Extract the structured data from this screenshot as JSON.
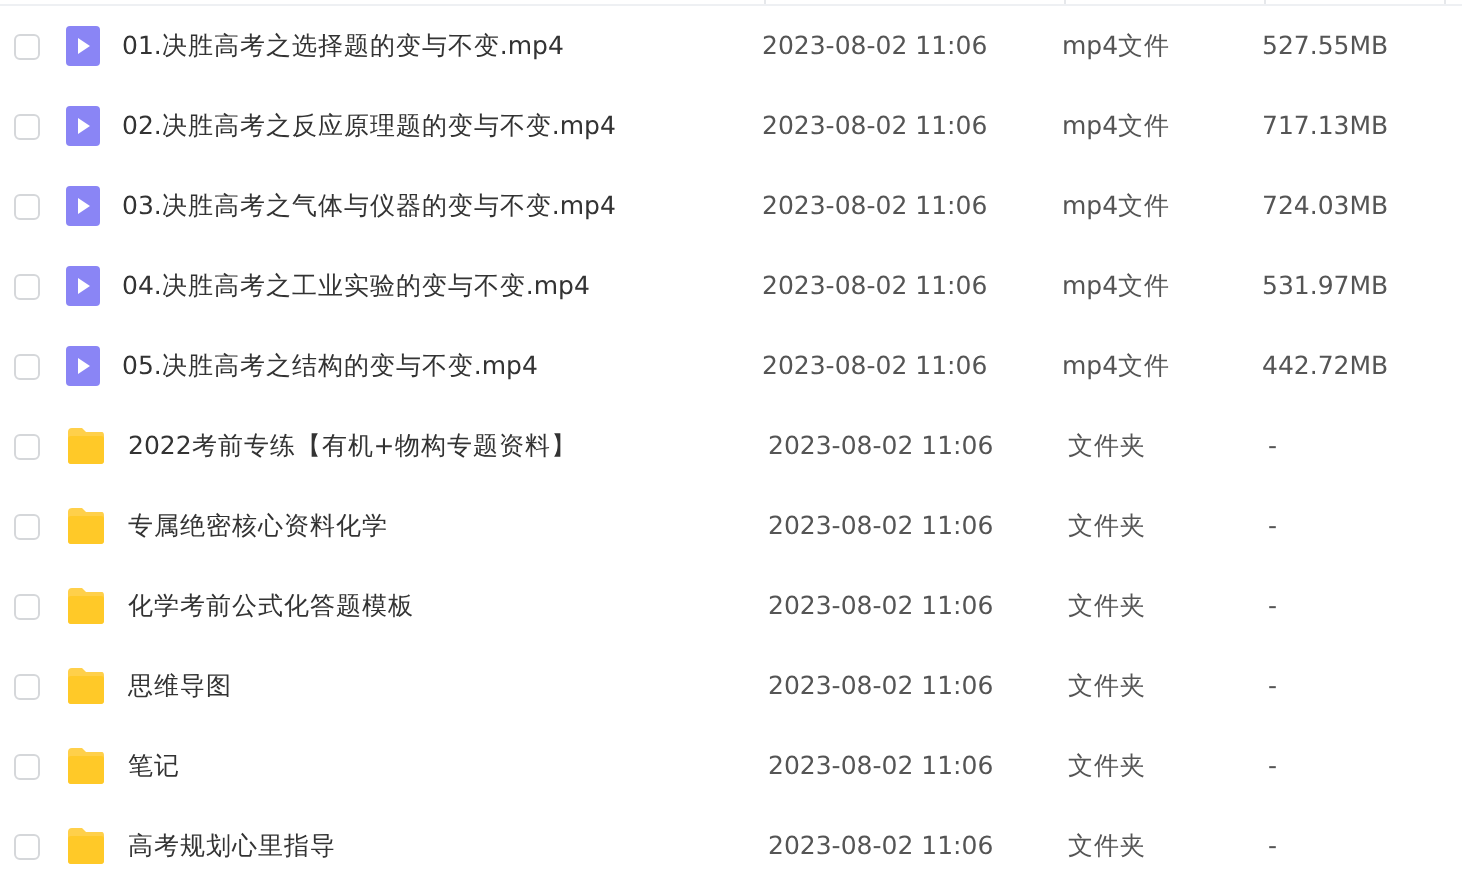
{
  "files": [
    {
      "kind": "video",
      "checked": false,
      "name": "01.决胜高考之选择题的变与不变.mp4",
      "modified": "2023-08-02 11:06",
      "type": "mp4文件",
      "size": "527.55MB"
    },
    {
      "kind": "video",
      "checked": false,
      "name": "02.决胜高考之反应原理题的变与不变.mp4",
      "modified": "2023-08-02 11:06",
      "type": "mp4文件",
      "size": "717.13MB"
    },
    {
      "kind": "video",
      "checked": false,
      "name": "03.决胜高考之气体与仪器的变与不变.mp4",
      "modified": "2023-08-02 11:06",
      "type": "mp4文件",
      "size": "724.03MB"
    },
    {
      "kind": "video",
      "checked": false,
      "name": "04.决胜高考之工业实验的变与不变.mp4",
      "modified": "2023-08-02 11:06",
      "type": "mp4文件",
      "size": "531.97MB"
    },
    {
      "kind": "video",
      "checked": false,
      "name": "05.决胜高考之结构的变与不变.mp4",
      "modified": "2023-08-02 11:06",
      "type": "mp4文件",
      "size": "442.72MB"
    },
    {
      "kind": "folder",
      "checked": false,
      "name": "2022考前专练【有机+物构专题资料】",
      "modified": "2023-08-02 11:06",
      "type": "文件夹",
      "size": "-"
    },
    {
      "kind": "folder",
      "checked": false,
      "name": "专属绝密核心资料化学",
      "modified": "2023-08-02 11:06",
      "type": "文件夹",
      "size": "-"
    },
    {
      "kind": "folder",
      "checked": false,
      "name": "化学考前公式化答题模板",
      "modified": "2023-08-02 11:06",
      "type": "文件夹",
      "size": "-"
    },
    {
      "kind": "folder",
      "checked": false,
      "name": "思维导图",
      "modified": "2023-08-02 11:06",
      "type": "文件夹",
      "size": "-"
    },
    {
      "kind": "folder",
      "checked": false,
      "name": "笔记",
      "modified": "2023-08-02 11:06",
      "type": "文件夹",
      "size": "-"
    },
    {
      "kind": "folder",
      "checked": false,
      "name": "高考规划心里指导",
      "modified": "2023-08-02 11:06",
      "type": "文件夹",
      "size": "-"
    }
  ]
}
